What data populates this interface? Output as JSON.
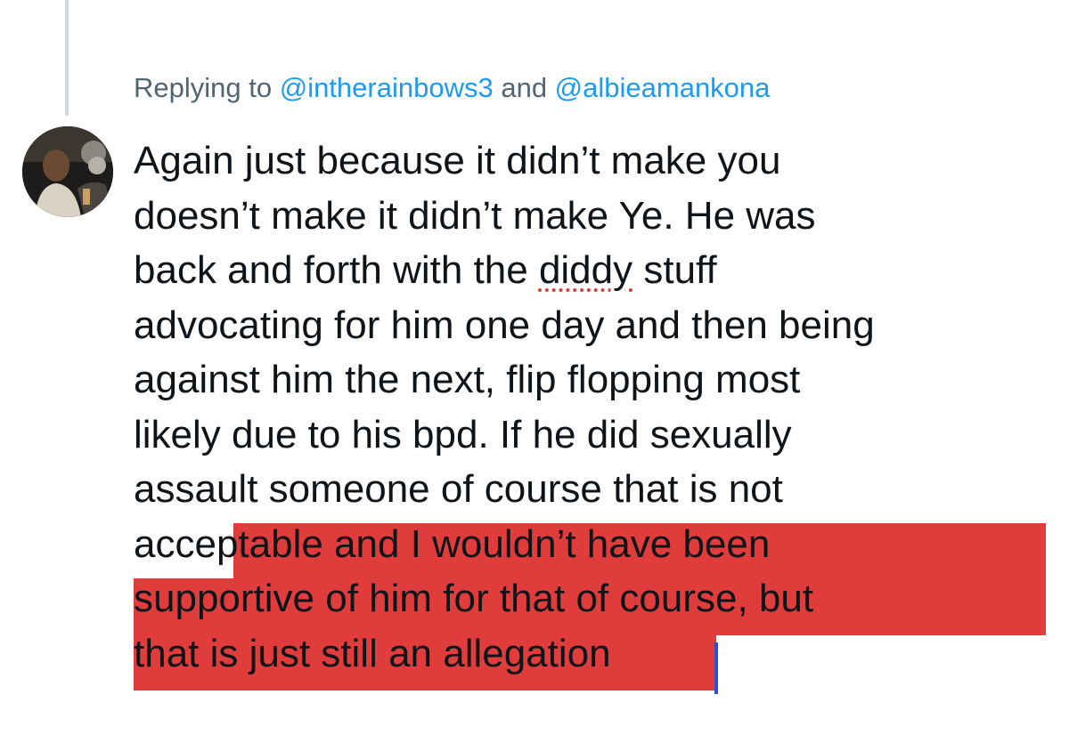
{
  "reply": {
    "prefix": "Replying to ",
    "mention_1": "@intherainbows3",
    "conjunction": " and ",
    "mention_2": "@albieamankona"
  },
  "tweet": {
    "lines": [
      [
        "Again just because it didn’t make you"
      ],
      [
        "doesn’t make it didn’t make Ye. He was"
      ],
      [
        "back and forth with the ",
        "diddy",
        " stuff"
      ],
      [
        "advocating for him one day and then being"
      ],
      [
        "against him the next, flip flopping most"
      ],
      [
        "likely due to his bpd. If he did sexually"
      ],
      [
        "assault someone of course that is not"
      ],
      [
        "acce",
        "ptable and I wouldn’t have been"
      ],
      [
        "supportive of him for that of course, but"
      ],
      [
        "that is just still an allegation"
      ]
    ],
    "misspelled_word": "diddy",
    "highlight_percent_line_8_start": 0.35
  },
  "avatar": {
    "icon": "profile-photo"
  },
  "colors": {
    "mention": "#1d9bf0",
    "secondary_text": "#536471",
    "primary_text": "#0f1419",
    "highlight": "#e03c3c",
    "thread_line": "#cfd9de",
    "selection_caret": "#2f4fd0",
    "spellcheck_underline": "#d2452f"
  }
}
